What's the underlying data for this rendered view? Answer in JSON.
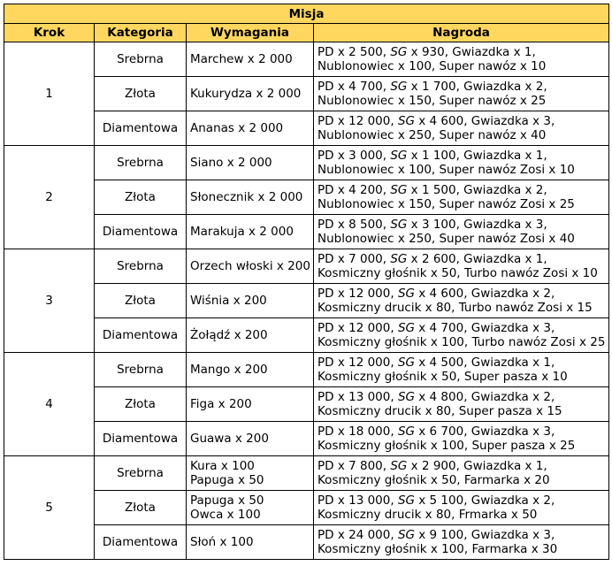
{
  "title": "Misja",
  "headers": {
    "step": "Krok",
    "category": "Kategoria",
    "requirements": "Wymagania",
    "reward": "Nagroda"
  },
  "steps": [
    {
      "step": "1",
      "rows": [
        {
          "category": "Srebrna",
          "req": [
            "Marchew x 2 000"
          ],
          "reward": [
            "PD x 2 500, SG x 930, Gwiazdka x 1,",
            "Nublonowiec x 100, Super nawóz x 10"
          ]
        },
        {
          "category": "Złota",
          "req": [
            "Kukurydza x 2 000"
          ],
          "reward": [
            "PD x 4 700, SG x 1 700, Gwiazdka x 2,",
            "Nublonowiec x 150, Super nawóz x 25"
          ]
        },
        {
          "category": "Diamentowa",
          "req": [
            "Ananas x 2 000"
          ],
          "reward": [
            "PD x 12 000, SG x 4 600, Gwiazdka x 3,",
            "Nublonowiec x 250, Super nawóz x 40"
          ]
        }
      ]
    },
    {
      "step": "2",
      "rows": [
        {
          "category": "Srebrna",
          "req": [
            "Siano x 2 000"
          ],
          "reward": [
            "PD x 3 000, SG x 1 100, Gwiazdka x 1,",
            "Nublonowiec x 100, Super nawóz Zosi x 10"
          ]
        },
        {
          "category": "Złota",
          "req": [
            "Słonecznik x 2 000"
          ],
          "reward": [
            "PD x 4 200, SG x 1 500, Gwiazdka x 2,",
            "Nublonowiec x 150, Super nawóz Zosi x 25"
          ]
        },
        {
          "category": "Diamentowa",
          "req": [
            "Marakuja x 2 000"
          ],
          "reward": [
            "PD x 8 500, SG x 3 100, Gwiazdka x 3,",
            "Nublonowiec x 250, Super nawóz Zosi x 40"
          ]
        }
      ]
    },
    {
      "step": "3",
      "rows": [
        {
          "category": "Srebrna",
          "req": [
            "Orzech włoski x 200"
          ],
          "reward": [
            "PD x 7 000, SG x 2 600, Gwiazdka x 1,",
            "Kosmiczny głośnik x 50, Turbo nawóz Zosi x 10"
          ]
        },
        {
          "category": "Złota",
          "req": [
            "Wiśnia x 200"
          ],
          "reward": [
            "PD x 12 000, SG x 4 600, Gwiazdka x 2,",
            "Kosmiczny drucik x 80, Turbo nawóz Zosi x 15"
          ]
        },
        {
          "category": "Diamentowa",
          "req": [
            "Żołądź x 200"
          ],
          "reward": [
            "PD x 12 000, SG x 4 700, Gwiazdka x 3,",
            "Kosmiczny głośnik x 100, Turbo nawóz Zosi x 25"
          ]
        }
      ]
    },
    {
      "step": "4",
      "rows": [
        {
          "category": "Srebrna",
          "req": [
            "Mango x 200"
          ],
          "reward": [
            "PD x 12 000, SG x 4 500, Gwiazdka x 1,",
            "Kosmiczny głośnik x 50, Super pasza x 10"
          ]
        },
        {
          "category": "Złota",
          "req": [
            "Figa x 200"
          ],
          "reward": [
            "PD x 13 000, SG x 4 800, Gwiazdka x 2,",
            "Kosmiczny drucik x 80, Super pasza x 15"
          ]
        },
        {
          "category": "Diamentowa",
          "req": [
            "Guawa x 200"
          ],
          "reward": [
            "PD x 18 000, SG x 6 700, Gwiazdka x 3,",
            "Kosmiczny głośnik x 100, Super pasza x 25"
          ]
        }
      ]
    },
    {
      "step": "5",
      "rows": [
        {
          "category": "Srebrna",
          "req": [
            "Kura x 100",
            "Papuga x 50"
          ],
          "reward": [
            "PD x 7 800, SG x 2 900, Gwiazdka x 1,",
            "Kosmiczny głośnik x 50, Farmarka x 20"
          ]
        },
        {
          "category": "Złota",
          "req": [
            "Papuga x 50",
            "Owca x 100"
          ],
          "reward": [
            "PD x 13 000, SG x 5 100, Gwiazdka x 2,",
            "Kosmiczny drucik x 80, Frmarka x 50"
          ]
        },
        {
          "category": "Diamentowa",
          "req": [
            "Słoń x 100"
          ],
          "reward": [
            "PD x 24 000, SG x 9 100, Gwiazdka x 3,",
            "Kosmiczny głośnik x 100, Farmarka x 30"
          ]
        }
      ]
    }
  ]
}
